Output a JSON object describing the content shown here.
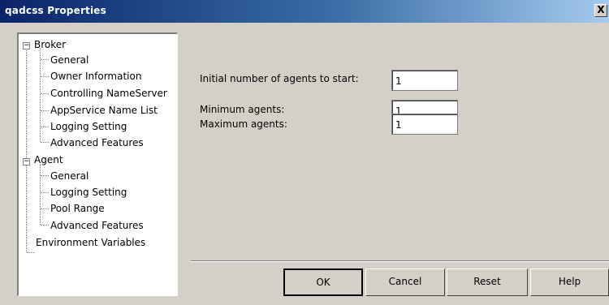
{
  "window": {
    "title": "qadcss Properties",
    "close_label": "X"
  },
  "tree": {
    "expander_symbol": "−",
    "broker": {
      "label": "Broker",
      "children": [
        "General",
        "Owner Information",
        "Controlling NameServer",
        "AppService Name List",
        "Logging Setting",
        "Advanced Features"
      ]
    },
    "agent": {
      "label": "Agent",
      "children": [
        "General",
        "Logging Setting",
        "Pool Range",
        "Advanced Features"
      ]
    },
    "environment": {
      "label": "Environment Variables"
    }
  },
  "form": {
    "initial_agents": {
      "label": "Initial number of agents to start:",
      "value": "1"
    },
    "minimum_agents": {
      "label": "Minimum agents:",
      "value": "1"
    },
    "maximum_agents": {
      "label": "Maximum agents:",
      "value": "1"
    }
  },
  "buttons": {
    "ok": "OK",
    "cancel": "Cancel",
    "reset": "Reset",
    "help": "Help"
  }
}
